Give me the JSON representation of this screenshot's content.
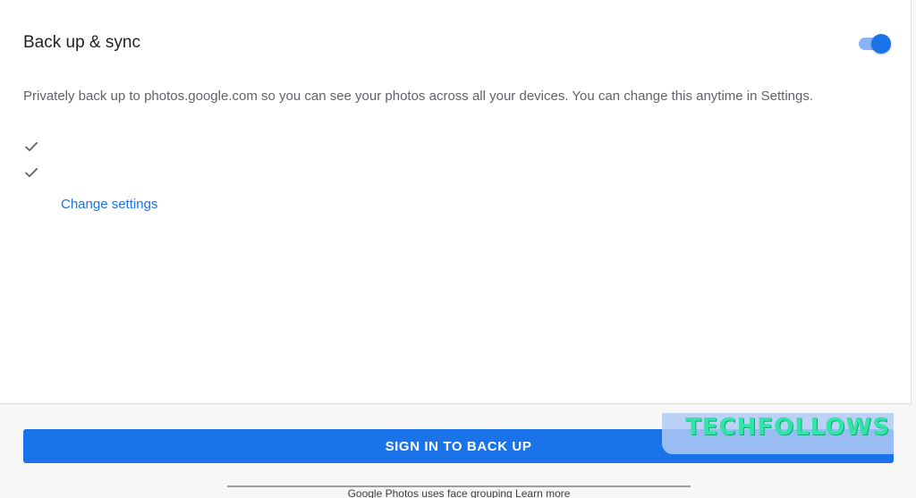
{
  "settings": {
    "title": "Back up & sync",
    "toggle_on": true,
    "description": "Privately back up to photos.google.com so you can see your photos across all your devices. You can change this anytime in Settings.",
    "change_settings_label": "Change settings"
  },
  "actions": {
    "sign_in_label": "SIGN IN TO BACK UP"
  },
  "footer": {
    "text": "Google Photos uses face grouping",
    "learn_more": "Learn more"
  },
  "watermark": {
    "text": "TECHFOLLOWS"
  },
  "colors": {
    "accent": "#1a73e8",
    "toggle_track": "#8ab4f8",
    "watermark": "#2ee6a6"
  },
  "icons": {
    "check": "check-icon"
  }
}
